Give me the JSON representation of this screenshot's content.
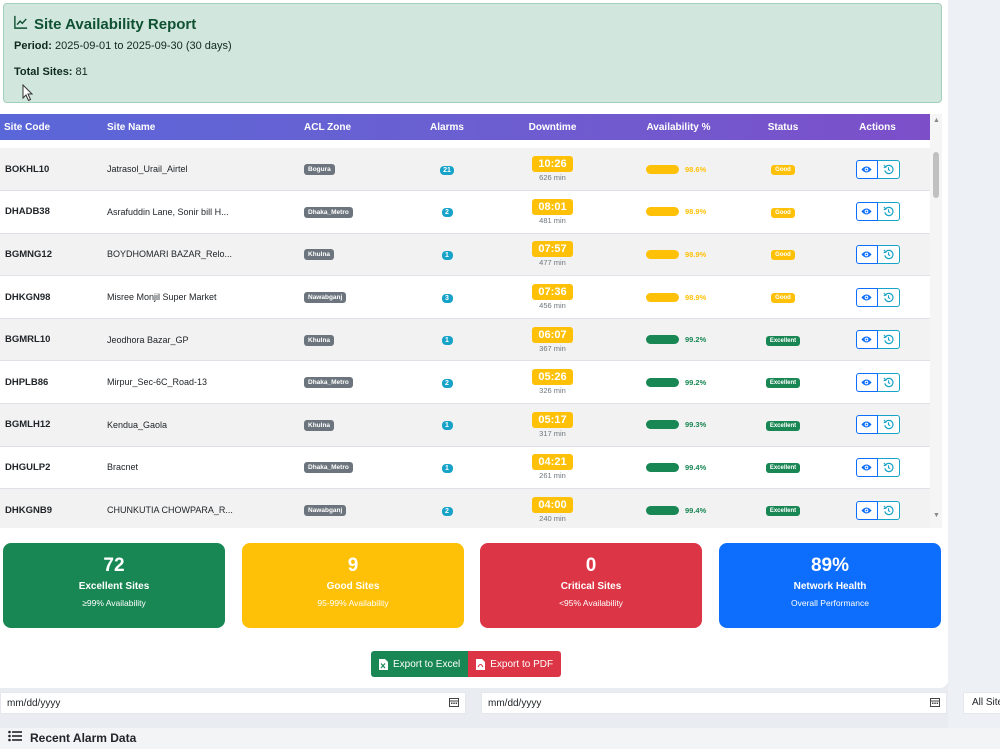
{
  "header": {
    "title": "Site Availability Report",
    "period_label": "Period:",
    "period_value": "2025-09-01 to 2025-09-30 (30 days)",
    "total_label": "Total Sites:",
    "total_value": "81"
  },
  "table": {
    "columns": [
      "Site Code",
      "Site Name",
      "ACL Zone",
      "Alarms",
      "Downtime",
      "Availability %",
      "Status",
      "Actions"
    ],
    "rows": [
      {
        "code": "BOKHL10",
        "name": "Jatrasol_Urail_Airtel",
        "zone": "Bogura",
        "alarms": "21",
        "downtime": "10:26",
        "minutes": "626 min",
        "availability": "98.6%",
        "availability_value": 98.6,
        "status": "Good",
        "level": "good"
      },
      {
        "code": "DHADB38",
        "name": "Asrafuddin Lane, Sonir bill H...",
        "zone": "Dhaka_Metro",
        "alarms": "2",
        "downtime": "08:01",
        "minutes": "481 min",
        "availability": "98.9%",
        "availability_value": 98.9,
        "status": "Good",
        "level": "good"
      },
      {
        "code": "BGMNG12",
        "name": "BOYDHOMARI BAZAR_Relo...",
        "zone": "Khulna",
        "alarms": "1",
        "downtime": "07:57",
        "minutes": "477 min",
        "availability": "98.9%",
        "availability_value": 98.9,
        "status": "Good",
        "level": "good"
      },
      {
        "code": "DHKGN98",
        "name": "Misree Monjil Super Market",
        "zone": "Nawabganj",
        "alarms": "3",
        "downtime": "07:36",
        "minutes": "456 min",
        "availability": "98.9%",
        "availability_value": 98.9,
        "status": "Good",
        "level": "good"
      },
      {
        "code": "BGMRL10",
        "name": "Jeodhora Bazar_GP",
        "zone": "Khulna",
        "alarms": "1",
        "downtime": "06:07",
        "minutes": "367 min",
        "availability": "99.2%",
        "availability_value": 99.2,
        "status": "Excellent",
        "level": "exc"
      },
      {
        "code": "DHPLB86",
        "name": "Mirpur_Sec-6C_Road-13",
        "zone": "Dhaka_Metro",
        "alarms": "2",
        "downtime": "05:26",
        "minutes": "326 min",
        "availability": "99.2%",
        "availability_value": 99.2,
        "status": "Excellent",
        "level": "exc"
      },
      {
        "code": "BGMLH12",
        "name": "Kendua_Gaola",
        "zone": "Khulna",
        "alarms": "1",
        "downtime": "05:17",
        "minutes": "317 min",
        "availability": "99.3%",
        "availability_value": 99.3,
        "status": "Excellent",
        "level": "exc"
      },
      {
        "code": "DHGULP2",
        "name": "Bracnet",
        "zone": "Dhaka_Metro",
        "alarms": "1",
        "downtime": "04:21",
        "minutes": "261 min",
        "availability": "99.4%",
        "availability_value": 99.4,
        "status": "Excellent",
        "level": "exc"
      },
      {
        "code": "DHKGNB9",
        "name": "CHUNKUTIA CHOWPARA_R...",
        "zone": "Nawabganj",
        "alarms": "2",
        "downtime": "04:00",
        "minutes": "240 min",
        "availability": "99.4%",
        "availability_value": 99.4,
        "status": "Excellent",
        "level": "exc"
      }
    ]
  },
  "cards": {
    "excellent": {
      "value": "72",
      "label": "Excellent Sites",
      "sub": "≥99% Availability"
    },
    "good": {
      "value": "9",
      "label": "Good Sites",
      "sub": "95-99% Availability"
    },
    "critical": {
      "value": "0",
      "label": "Critical Sites",
      "sub": "<95% Availability"
    },
    "health": {
      "value": "89%",
      "label": "Network Health",
      "sub": "Overall Performance"
    }
  },
  "export": {
    "excel_label": "Export to Excel",
    "pdf_label": "Export to PDF"
  },
  "filters": {
    "start_placeholder": "mm/dd/yyyy",
    "end_placeholder": "mm/dd/yyyy",
    "site_select": "All Sites"
  },
  "section": {
    "title": "Recent Alarm Data"
  },
  "colors": {
    "good": "#ffc107",
    "excellent": "#198754",
    "critical": "#dc3545",
    "health": "#0d6efd",
    "header_bg": "#d1e7dd"
  }
}
